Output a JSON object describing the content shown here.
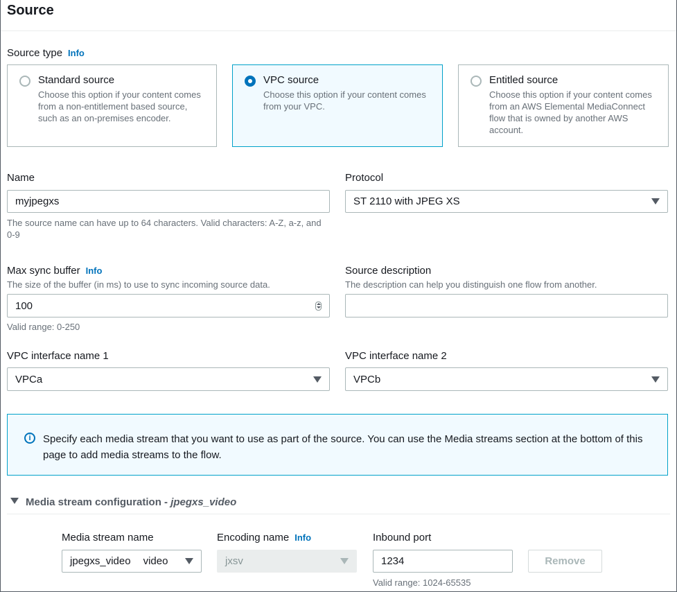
{
  "section": {
    "title": "Source"
  },
  "source_type": {
    "label": "Source type",
    "info": "Info",
    "options": [
      {
        "title": "Standard source",
        "description": "Choose this option if your content comes from a non-entitlement based source, such as an on-premises encoder.",
        "selected": false
      },
      {
        "title": "VPC source",
        "description": "Choose this option if your content comes from your VPC.",
        "selected": true
      },
      {
        "title": "Entitled source",
        "description": "Choose this option if your content comes from an AWS Elemental MediaConnect flow that is owned by another AWS account.",
        "selected": false
      }
    ]
  },
  "name": {
    "label": "Name",
    "value": "myjpegxs",
    "hint": "The source name can have up to 64 characters. Valid characters: A-Z, a-z, and 0-9"
  },
  "protocol": {
    "label": "Protocol",
    "value": "ST 2110 with JPEG XS"
  },
  "max_sync_buffer": {
    "label": "Max sync buffer",
    "info": "Info",
    "description": "The size of the buffer (in ms) to use to sync incoming source data.",
    "value": "100",
    "hint": "Valid range: 0-250"
  },
  "source_description": {
    "label": "Source description",
    "description": "The description can help you distinguish one flow from another.",
    "value": ""
  },
  "vpc_interface_1": {
    "label": "VPC interface name 1",
    "value": "VPCa"
  },
  "vpc_interface_2": {
    "label": "VPC interface name 2",
    "value": "VPCb"
  },
  "alert": {
    "text": "Specify each media stream that you want to use as part of the source. You can use the Media streams section at the bottom of this page to add media streams to the flow."
  },
  "media_stream_config": {
    "heading_prefix": "Media stream configuration - ",
    "heading_name": "jpegxs_video",
    "media_stream_name": {
      "label": "Media stream name",
      "value": "jpegxs_video",
      "type": "video"
    },
    "encoding_name": {
      "label": "Encoding name",
      "info": "Info",
      "value": "jxsv"
    },
    "inbound_port": {
      "label": "Inbound port",
      "value": "1234",
      "hint": "Valid range: 1024-65535"
    },
    "remove_label": "Remove"
  },
  "colors": {
    "accent": "#0073bb",
    "selected_border": "#00a1c9",
    "selected_bg": "#f1faff"
  }
}
